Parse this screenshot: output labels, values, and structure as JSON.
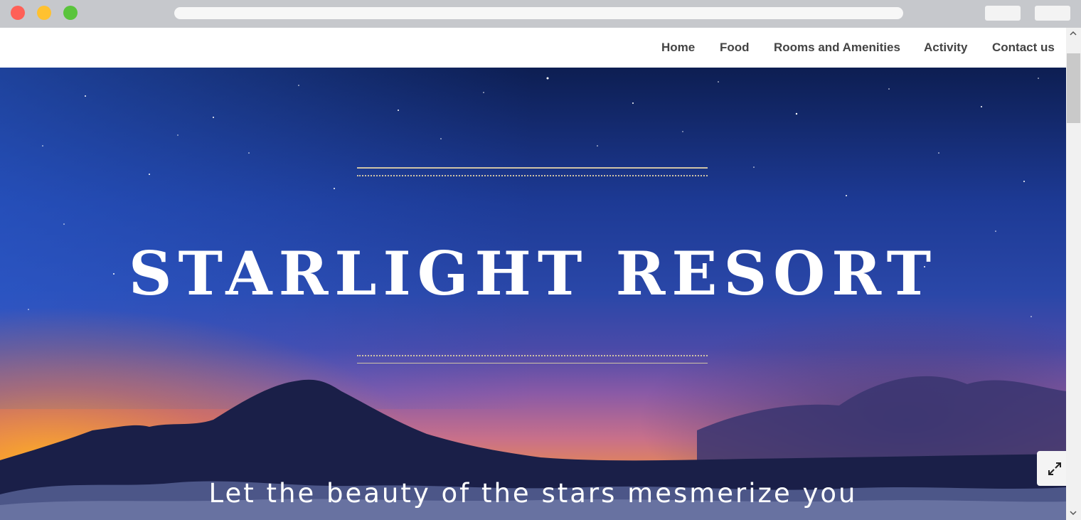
{
  "nav": {
    "items": [
      {
        "label": "Home"
      },
      {
        "label": "Food"
      },
      {
        "label": "Rooms and Amenities"
      },
      {
        "label": "Activity"
      },
      {
        "label": "Contact us"
      }
    ]
  },
  "hero": {
    "title": "STARLIGHT RESORT",
    "tagline": "Let the beauty of the stars mesmerize you",
    "expand_icon": "expand-arrows-icon"
  },
  "colors": {
    "window_red": "#ff6057",
    "window_yellow": "#ffc130",
    "window_green": "#5ac43c",
    "nav_text": "#444444",
    "accent_rule": "#cfc3a6",
    "sky_top": "#0d1e52",
    "sky_mid": "#2a47a8",
    "horizon": "#f0a030"
  }
}
